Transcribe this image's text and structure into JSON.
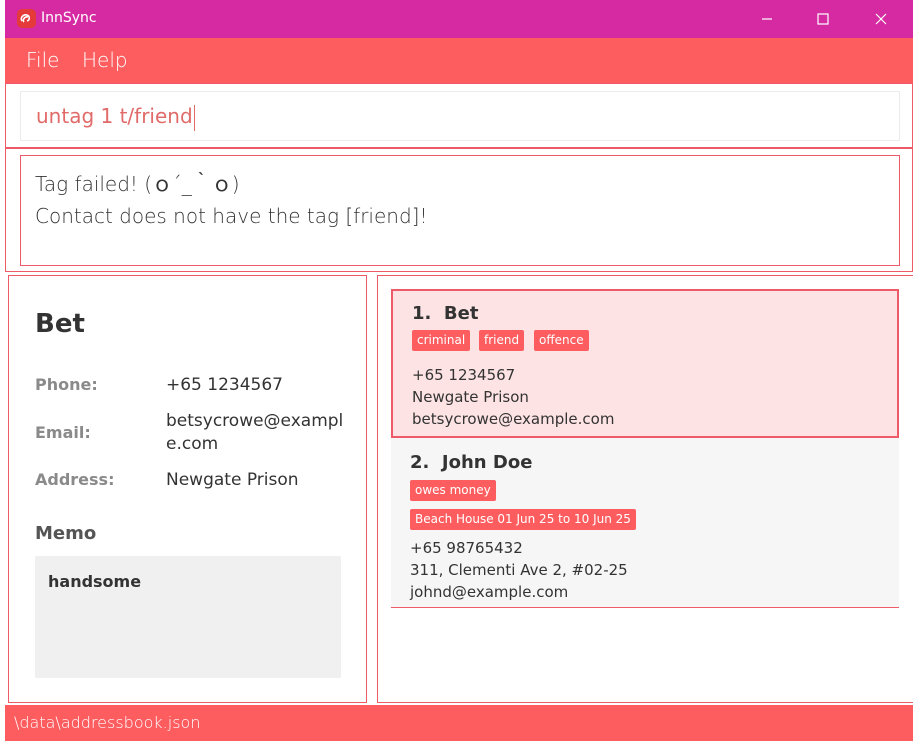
{
  "window": {
    "title": "InnSync",
    "controls": {
      "minimize_icon": "minimize-icon",
      "maximize_icon": "maximize-icon",
      "close_icon": "close-icon"
    },
    "title_bar_color": "#d62aa3"
  },
  "menu": {
    "items": [
      {
        "label": "File"
      },
      {
        "label": "Help"
      }
    ],
    "color": "#fe5d60"
  },
  "command_box": {
    "value": "untag 1 t/friend"
  },
  "result": {
    "lines": [
      "Tag failed! (ｏ´_｀ｏ)",
      "Contact does not have the tag [friend]!"
    ]
  },
  "detail": {
    "name": "Bet",
    "fields": [
      {
        "label": "Phone:",
        "value": "+65 1234567"
      },
      {
        "label": "Email:",
        "value": "betsycrowe@example.com"
      },
      {
        "label": "Address:",
        "value": "Newgate Prison"
      }
    ],
    "memo_title": "Memo",
    "memo_text": "handsome"
  },
  "contacts": [
    {
      "index": "1.",
      "name": "Bet",
      "tags": [
        "criminal",
        "friend",
        "offence"
      ],
      "bookings": [],
      "phone": "+65 1234567",
      "address": "Newgate Prison",
      "email": "betsycrowe@example.com",
      "selected": true
    },
    {
      "index": "2.",
      "name": "John Doe",
      "tags": [
        "owes money"
      ],
      "bookings": [
        "Beach House 01 Jun 25 to 10 Jun 25"
      ],
      "phone": "+65 98765432",
      "address": "311, Clementi Ave 2, #02-25",
      "email": "johnd@example.com",
      "selected": false
    }
  ],
  "status_bar": {
    "path": "\\data\\addressbook.json"
  },
  "colors": {
    "accent": "#fe5d60",
    "border": "#ee5a67",
    "selected_card": "#fde3e3"
  }
}
